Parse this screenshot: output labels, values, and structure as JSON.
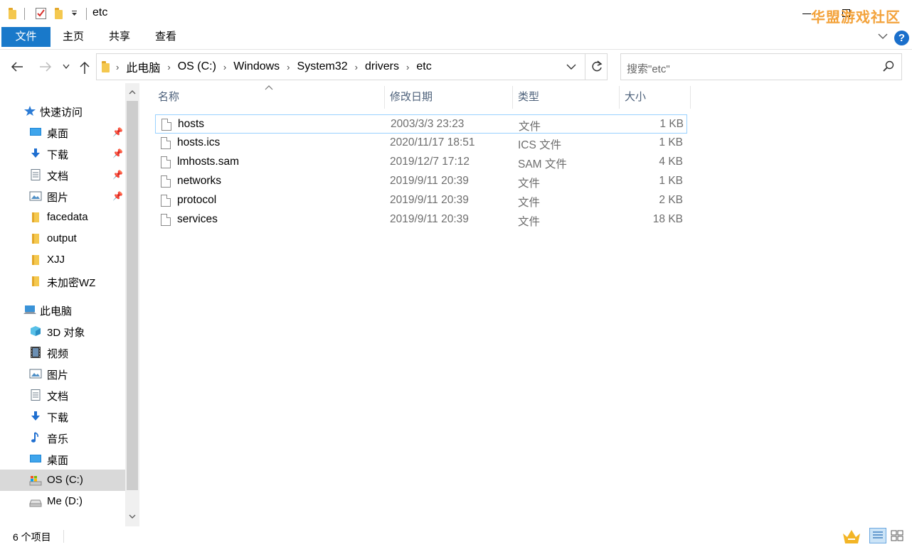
{
  "window": {
    "title": "etc",
    "watermark": "华盟游戏社区"
  },
  "ribbon": {
    "tabs": [
      "文件",
      "主页",
      "共享",
      "查看"
    ]
  },
  "address": {
    "crumbs": [
      "此电脑",
      "OS (C:)",
      "Windows",
      "System32",
      "drivers",
      "etc"
    ]
  },
  "search": {
    "placeholder": "搜索\"etc\""
  },
  "nav_pane": {
    "quick_access": {
      "label": "快速访问",
      "items": [
        {
          "label": "桌面",
          "icon": "desktop-icon",
          "pinned": true
        },
        {
          "label": "下载",
          "icon": "download-icon",
          "pinned": true
        },
        {
          "label": "文档",
          "icon": "document-icon",
          "pinned": true
        },
        {
          "label": "图片",
          "icon": "picture-icon",
          "pinned": true
        },
        {
          "label": "facedata",
          "icon": "folder-icon",
          "pinned": false
        },
        {
          "label": "output",
          "icon": "folder-icon",
          "pinned": false
        },
        {
          "label": "XJJ",
          "icon": "folder-icon",
          "pinned": false
        },
        {
          "label": "未加密WZ",
          "icon": "folder-icon",
          "pinned": false
        }
      ]
    },
    "this_pc": {
      "label": "此电脑",
      "items": [
        {
          "label": "3D 对象",
          "icon": "3d-objects-icon"
        },
        {
          "label": "视频",
          "icon": "video-icon"
        },
        {
          "label": "图片",
          "icon": "picture-icon"
        },
        {
          "label": "文档",
          "icon": "document-icon"
        },
        {
          "label": "下载",
          "icon": "download-icon"
        },
        {
          "label": "音乐",
          "icon": "music-icon"
        },
        {
          "label": "桌面",
          "icon": "desktop-icon"
        },
        {
          "label": "OS (C:)",
          "icon": "os-drive-icon",
          "selected": true
        },
        {
          "label": "Me (D:)",
          "icon": "drive-icon"
        }
      ]
    }
  },
  "file_list": {
    "columns": [
      "名称",
      "修改日期",
      "类型",
      "大小"
    ],
    "rows": [
      {
        "name": "hosts",
        "date": "2003/3/3 23:23",
        "type": "文件",
        "size": "1 KB",
        "selected": true
      },
      {
        "name": "hosts.ics",
        "date": "2020/11/17 18:51",
        "type": "ICS 文件",
        "size": "1 KB"
      },
      {
        "name": "lmhosts.sam",
        "date": "2019/12/7 17:12",
        "type": "SAM 文件",
        "size": "4 KB"
      },
      {
        "name": "networks",
        "date": "2019/9/11 20:39",
        "type": "文件",
        "size": "1 KB"
      },
      {
        "name": "protocol",
        "date": "2019/9/11 20:39",
        "type": "文件",
        "size": "2 KB"
      },
      {
        "name": "services",
        "date": "2019/9/11 20:39",
        "type": "文件",
        "size": "18 KB"
      }
    ]
  },
  "status": {
    "item_count": "6 个项目"
  },
  "colors": {
    "accent": "#1979ca",
    "selection_border": "#99d1ff",
    "header_text": "#4c607a",
    "watermark": "#f3a23a"
  }
}
